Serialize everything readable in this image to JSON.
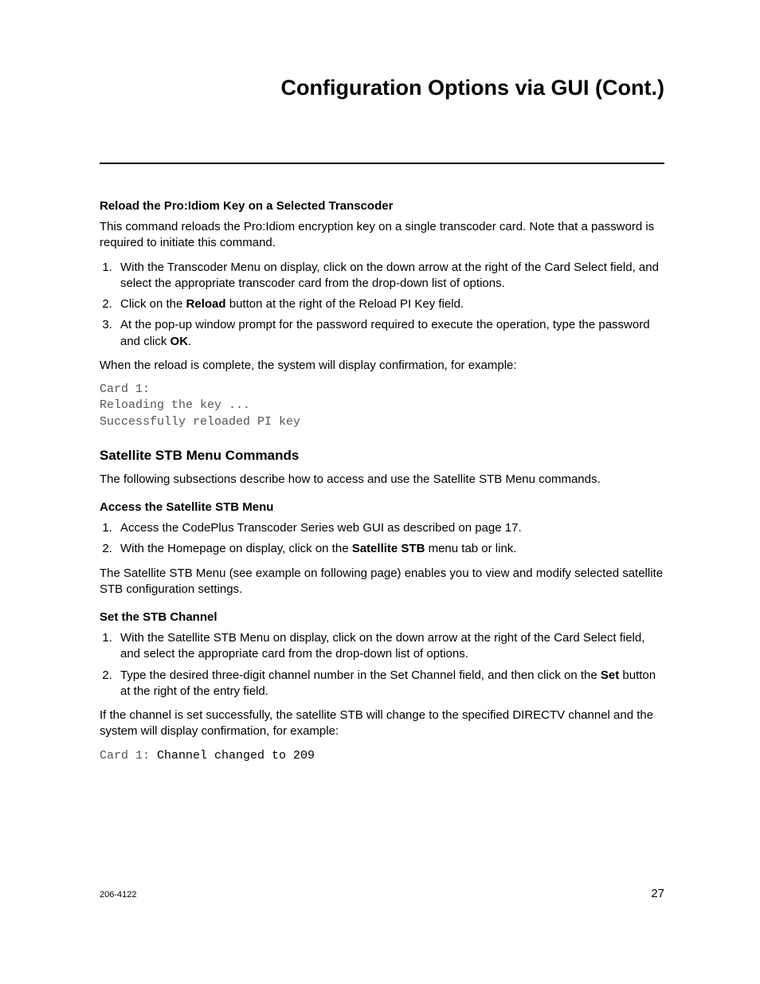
{
  "title": "Configuration Options via GUI (Cont.)",
  "s1": {
    "heading": "Reload the Pro:Idiom Key on a Selected Transcoder",
    "intro": "This command reloads the Pro:Idiom encryption key on a single transcoder card. Note that a password is required to initiate this command.",
    "step1": "With the Transcoder Menu on display, click on the down arrow at the right of the Card Select field, and select the appropriate transcoder card from the drop-down list of options.",
    "step2_pre": "Click on the ",
    "step2_b": "Reload",
    "step2_post": " button at the right of the Reload PI Key field.",
    "step3_pre": "At the pop-up window prompt for the password required to execute the operation, type the password and click ",
    "step3_b": "OK",
    "step3_post": ".",
    "after": "When the reload is complete, the system will display confirmation, for example:",
    "code": "Card 1:\nReloading the key ...\nSuccessfully reloaded PI key"
  },
  "s2": {
    "heading": "Satellite STB Menu Commands",
    "intro": "The following subsections describe how to access and use the Satellite STB Menu commands."
  },
  "s3": {
    "heading": "Access the Satellite STB Menu",
    "step1": "Access the CodePlus Transcoder Series web GUI as described on page 17.",
    "step2_pre": "With the Homepage on display, click on the ",
    "step2_b": "Satellite STB",
    "step2_post": " menu tab or link.",
    "after": "The Satellite STB Menu (see example on following page) enables you to view and modify selected satellite STB configuration settings."
  },
  "s4": {
    "heading": "Set the STB Channel",
    "step1": "With the Satellite STB Menu on display, click on the down arrow at the right of the Card Select field, and select the appropriate card from the drop-down list of options.",
    "step2_pre": "Type the desired three-digit channel number in the Set Channel field, and then click on the ",
    "step2_b": "Set",
    "step2_post": " button at the right of the entry field.",
    "after": "If the channel is set successfully, the satellite STB will change to the specified DIRECTV channel and the system will display confirmation, for example:",
    "code_pre": "Card 1:",
    "code_post": " Channel changed to 209"
  },
  "footer": {
    "docnum": "206-4122",
    "pagenum": "27"
  }
}
